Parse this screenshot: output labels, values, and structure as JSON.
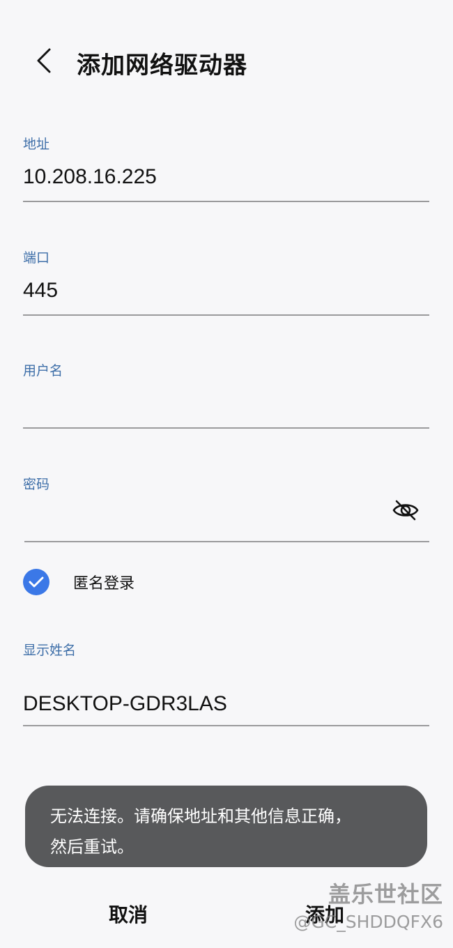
{
  "header": {
    "back_icon": "chevron-left-icon",
    "title": "添加网络驱动器"
  },
  "fields": {
    "address": {
      "label": "地址",
      "value": "10.208.16.225"
    },
    "port": {
      "label": "端口",
      "value": "445"
    },
    "username": {
      "label": "用户名",
      "value": ""
    },
    "password": {
      "label": "密码",
      "value": "",
      "toggle_icon": "eye-off-icon"
    },
    "display_name": {
      "label": "显示姓名",
      "value": "DESKTOP-GDR3LAS"
    }
  },
  "anonymous_login": {
    "label": "匿名登录",
    "checked": true
  },
  "toast": {
    "line1": "无法连接。请确保地址和其他信息正确，",
    "line2": "然后重试。"
  },
  "buttons": {
    "cancel": "取消",
    "add": "添加"
  },
  "watermark": {
    "brand": "盖乐世社区",
    "handle": "@GC_SHDDQFX6"
  },
  "colors": {
    "accent": "#3b78e7",
    "label": "#3d6ea8",
    "toast_bg": "#58595b"
  }
}
